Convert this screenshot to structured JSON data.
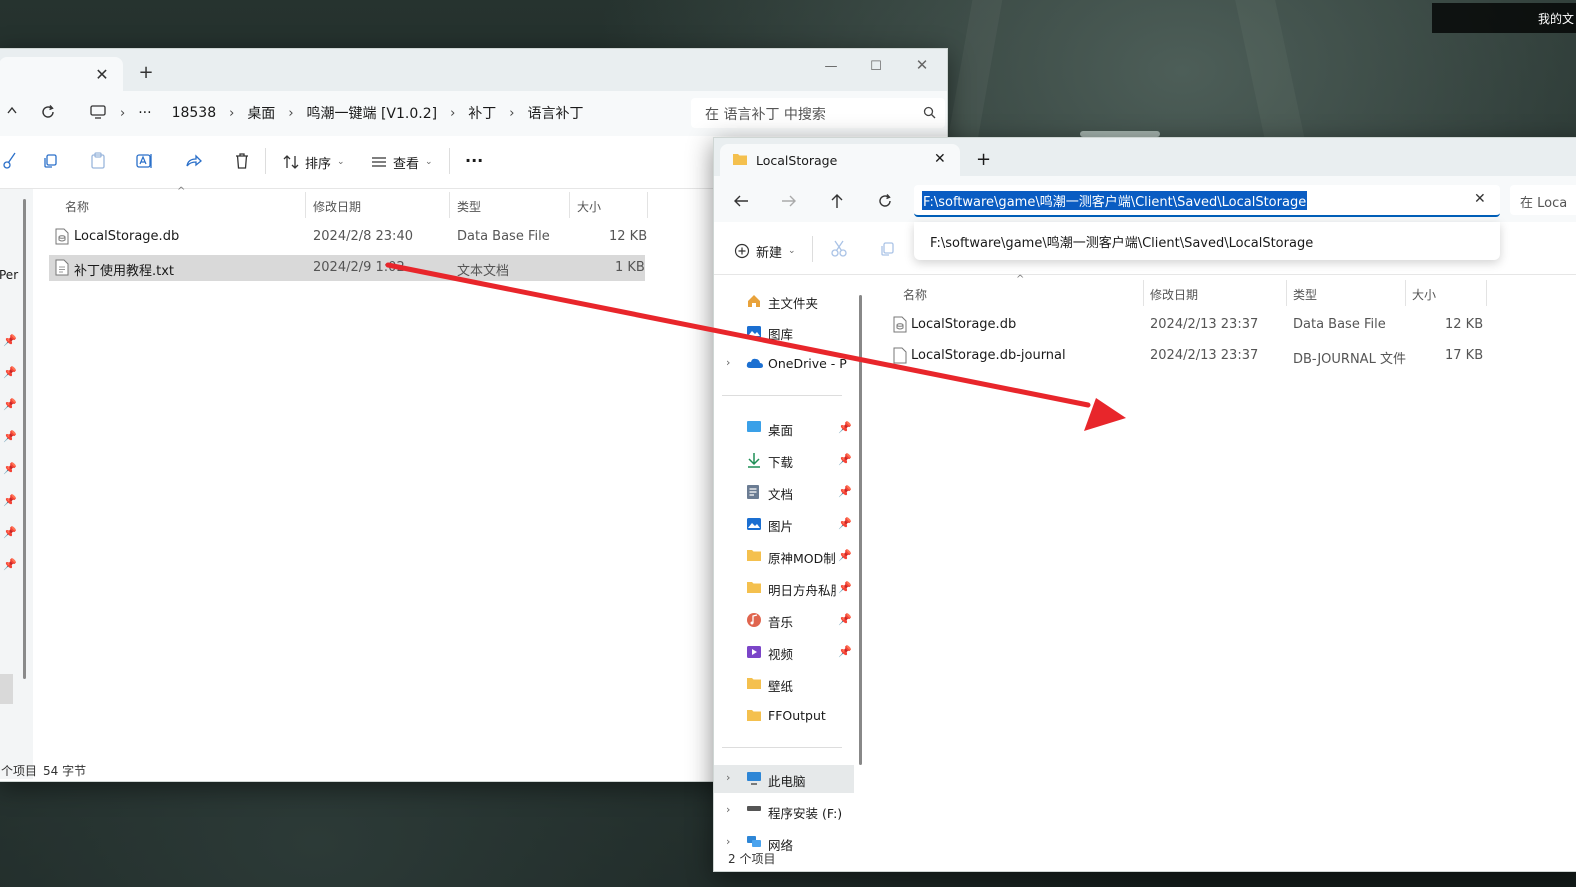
{
  "desktop": {
    "top_right_text": "我的文"
  },
  "win1": {
    "tab_close": "✕",
    "tab_add": "+",
    "controls": {
      "minimize": "—",
      "maximize": "☐",
      "close": "✕"
    },
    "breadcrumb": [
      "···",
      "18538",
      "桌面",
      "鸣潮一键端 [V1.0.2]",
      "补丁",
      "语言补丁"
    ],
    "search_placeholder": "在 语言补丁 中搜索",
    "toolbar": {
      "sort": "排序",
      "view": "查看",
      "more": "···"
    },
    "sidebar_fragment": "Per",
    "columns": [
      "名称",
      "修改日期",
      "类型",
      "大小"
    ],
    "files": [
      {
        "name": "LocalStorage.db",
        "date": "2024/2/8 23:40",
        "type": "Data Base File",
        "size": "12 KB"
      },
      {
        "name": "补丁使用教程.txt",
        "date": "2024/2/9 1:02",
        "type": "文本文档",
        "size": "1 KB"
      }
    ],
    "status": {
      "items": "个项目",
      "size": "54 字节"
    }
  },
  "win2": {
    "tab_title": "LocalStorage",
    "tab_close": "✕",
    "tab_add": "+",
    "address": "F:\\software\\game\\鸣潮一测客户端\\Client\\Saved\\LocalStorage",
    "address_clear": "✕",
    "search_fragment": "在 Loca",
    "suggestion": "F:\\software\\game\\鸣潮一测客户端\\Client\\Saved\\LocalStorage",
    "toolbar": {
      "new": "新建"
    },
    "nav": {
      "home": "主文件夹",
      "gallery": "图库",
      "onedrive": "OneDrive - P",
      "pinned": [
        {
          "label": "桌面",
          "icon": "desktop-icon"
        },
        {
          "label": "下载",
          "icon": "download-icon"
        },
        {
          "label": "文档",
          "icon": "document-icon"
        },
        {
          "label": "图片",
          "icon": "pictures-icon"
        },
        {
          "label": "原神MOD制",
          "icon": "folder-icon"
        },
        {
          "label": "明日方舟私服",
          "icon": "folder-icon"
        },
        {
          "label": "音乐",
          "icon": "music-icon"
        },
        {
          "label": "视频",
          "icon": "video-icon"
        },
        {
          "label": "壁纸",
          "icon": "folder-icon"
        },
        {
          "label": "FFOutput",
          "icon": "folder-icon"
        }
      ],
      "this_pc": "此电脑",
      "drive": "程序安装 (F:)",
      "network": "网络"
    },
    "columns": [
      "名称",
      "修改日期",
      "类型",
      "大小"
    ],
    "files": [
      {
        "name": "LocalStorage.db",
        "date": "2024/2/13 23:37",
        "type": "Data Base File",
        "size": "12 KB"
      },
      {
        "name": "LocalStorage.db-journal",
        "date": "2024/2/13 23:37",
        "type": "DB-JOURNAL 文件",
        "size": "17 KB"
      }
    ],
    "status": "2 个项目"
  },
  "colors": {
    "accent": "#005fb8",
    "selection": "#0a5cc2",
    "arrow": "#e8262b",
    "folder": "#f4c04e"
  }
}
